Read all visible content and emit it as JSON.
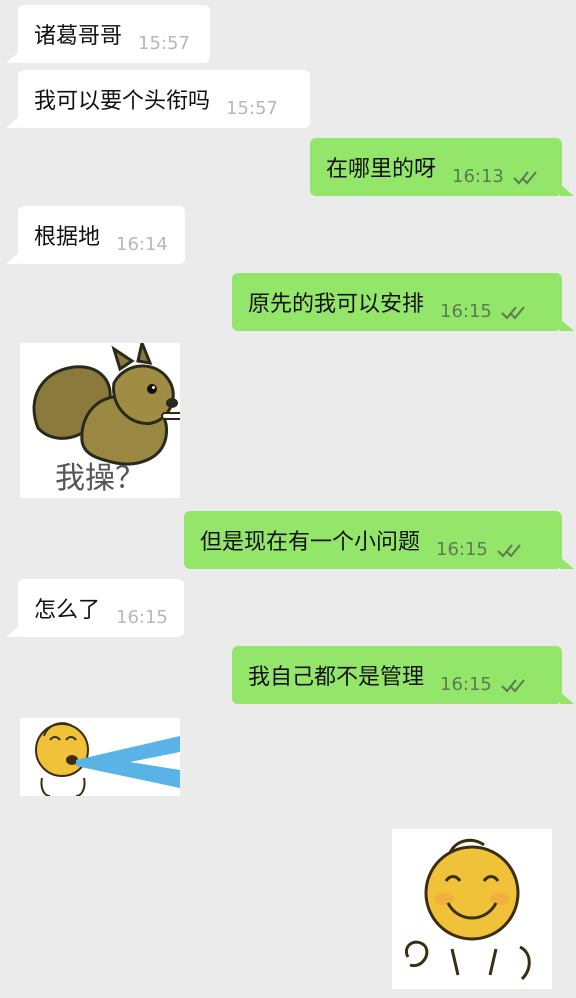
{
  "messages": [
    {
      "text": "诸葛哥哥",
      "time": "15:57",
      "dir": "in"
    },
    {
      "text": "我可以要个头衔吗",
      "time": "15:57",
      "dir": "in"
    },
    {
      "text": "在哪里的呀",
      "time": "16:13",
      "dir": "out"
    },
    {
      "text": "根据地",
      "time": "16:14",
      "dir": "in"
    },
    {
      "text": "原先的我可以安排",
      "time": "16:15",
      "dir": "out"
    },
    {
      "sticker_text": "我操？",
      "dir": "in"
    },
    {
      "text": "但是现在有一个小问题",
      "time": "16:15",
      "dir": "out"
    },
    {
      "text": "怎么了",
      "time": "16:15",
      "dir": "in"
    },
    {
      "text": "我自己都不是管理",
      "time": "16:15",
      "dir": "out"
    },
    {
      "sticker": "spitting-emoji",
      "dir": "in"
    },
    {
      "sticker": "smiling-emoji",
      "dir": "out"
    }
  ],
  "colors": {
    "background": "#ebebeb",
    "incoming_bubble": "#ffffff",
    "outgoing_bubble": "#93e66a"
  },
  "icons": {
    "read_receipt": "double-check-icon"
  }
}
